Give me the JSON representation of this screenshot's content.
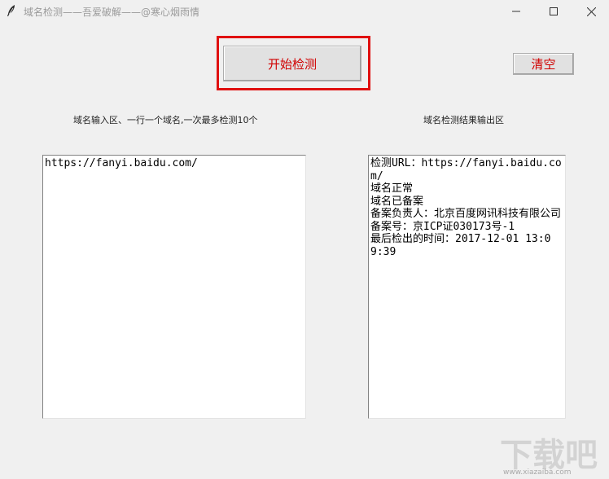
{
  "window": {
    "title": "域名检测——吾爱破解——@寒心烟雨情",
    "icon": "feather-icon"
  },
  "controls": {
    "minimize_icon": "minimize-icon",
    "maximize_icon": "maximize-icon",
    "close_icon": "close-icon"
  },
  "buttons": {
    "start_label": "开始检测",
    "clear_label": "清空"
  },
  "labels": {
    "input_area": "域名输入区、一行一个域名,一次最多检测10个",
    "output_area": "域名检测结果输出区"
  },
  "input": {
    "value": "https://fanyi.baidu.com/"
  },
  "output": {
    "lines": [
      "检测URL：https://fanyi.baidu.com/",
      "域名正常",
      "域名已备案",
      "备案负责人：北京百度网讯科技有限公司",
      "备案号：京ICP证030173号-1",
      "最后检出的时间：2017-12-01 13:09:39"
    ]
  },
  "watermark": {
    "text": "下载吧",
    "url": "www.xiazaiba.com"
  },
  "colors": {
    "button_text": "#d10000",
    "highlight_border": "#e01010",
    "background": "#f0f0f0"
  }
}
